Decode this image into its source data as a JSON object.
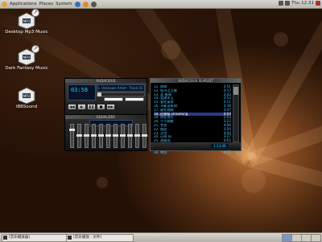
{
  "top_panel": {
    "menus": [
      "Applications",
      "Places",
      "System"
    ],
    "clock": "Thu 12:31"
  },
  "desktop_icons": [
    {
      "label": "Desktop Mp3 Music"
    },
    {
      "label": "Dark Fantasy Music"
    },
    {
      "label": "iBBSound"
    }
  ],
  "player": {
    "title": "AUDACIOUS",
    "time": "03:58",
    "track_info": "1. Unknown Artist - Track 01 (4:51)",
    "controls": [
      "◀◀",
      "▶",
      "❚❚",
      "■",
      "▶▶"
    ]
  },
  "equalizer": {
    "title": "EQUALIZER"
  },
  "playlist": {
    "title": "AUDACIOUS PLAYLIST",
    "items": [
      {
        "name": "11. 刻刻",
        "dur": "3:51"
      },
      {
        "name": "12. 牡丹江之夜",
        "dur": "4:17"
      },
      {
        "name": "13. 蓝 蔷薇",
        "dur": "3:43"
      },
      {
        "name": "14. 泪滴水上",
        "dur": "3:53"
      },
      {
        "name": "15. 爱在身旁",
        "dur": "4:11"
      },
      {
        "name": "16. 不能没有你",
        "dur": "3:39"
      },
      {
        "name": "17. 星在我眼",
        "dur": "3:47"
      },
      {
        "name": "18. 红蜻蜓 Dreaming",
        "dur": "4:04"
      },
      {
        "name": "19. 你在何方",
        "dur": "3:44"
      },
      {
        "name": "20. 千千阙歌",
        "dur": "3:22"
      },
      {
        "name": "21. 冬恋",
        "dur": "4:06"
      },
      {
        "name": "22. 相思",
        "dur": "3:50"
      },
      {
        "name": "23. 天空",
        "dur": "4:04"
      },
      {
        "name": "24. 心雨 风",
        "dur": "3:27"
      },
      {
        "name": "25. 流星雨",
        "dur": "4:02"
      },
      {
        "name": "26. 空港",
        "dur": "3:48"
      },
      {
        "name": "27. 月亮",
        "dur": "4:11"
      },
      {
        "name": "28. 吻别",
        "dur": "4:57"
      }
    ],
    "selected_index": 7,
    "total_time": "1:13:48"
  },
  "taskbar": {
    "tasks": [
      "[音乐播放器]",
      "[音乐播放 - 文件]"
    ]
  },
  "colors": {
    "accent": "#1ad2ff",
    "playlist_text": "#4ec6ff",
    "selection": "#2a3a8a"
  }
}
